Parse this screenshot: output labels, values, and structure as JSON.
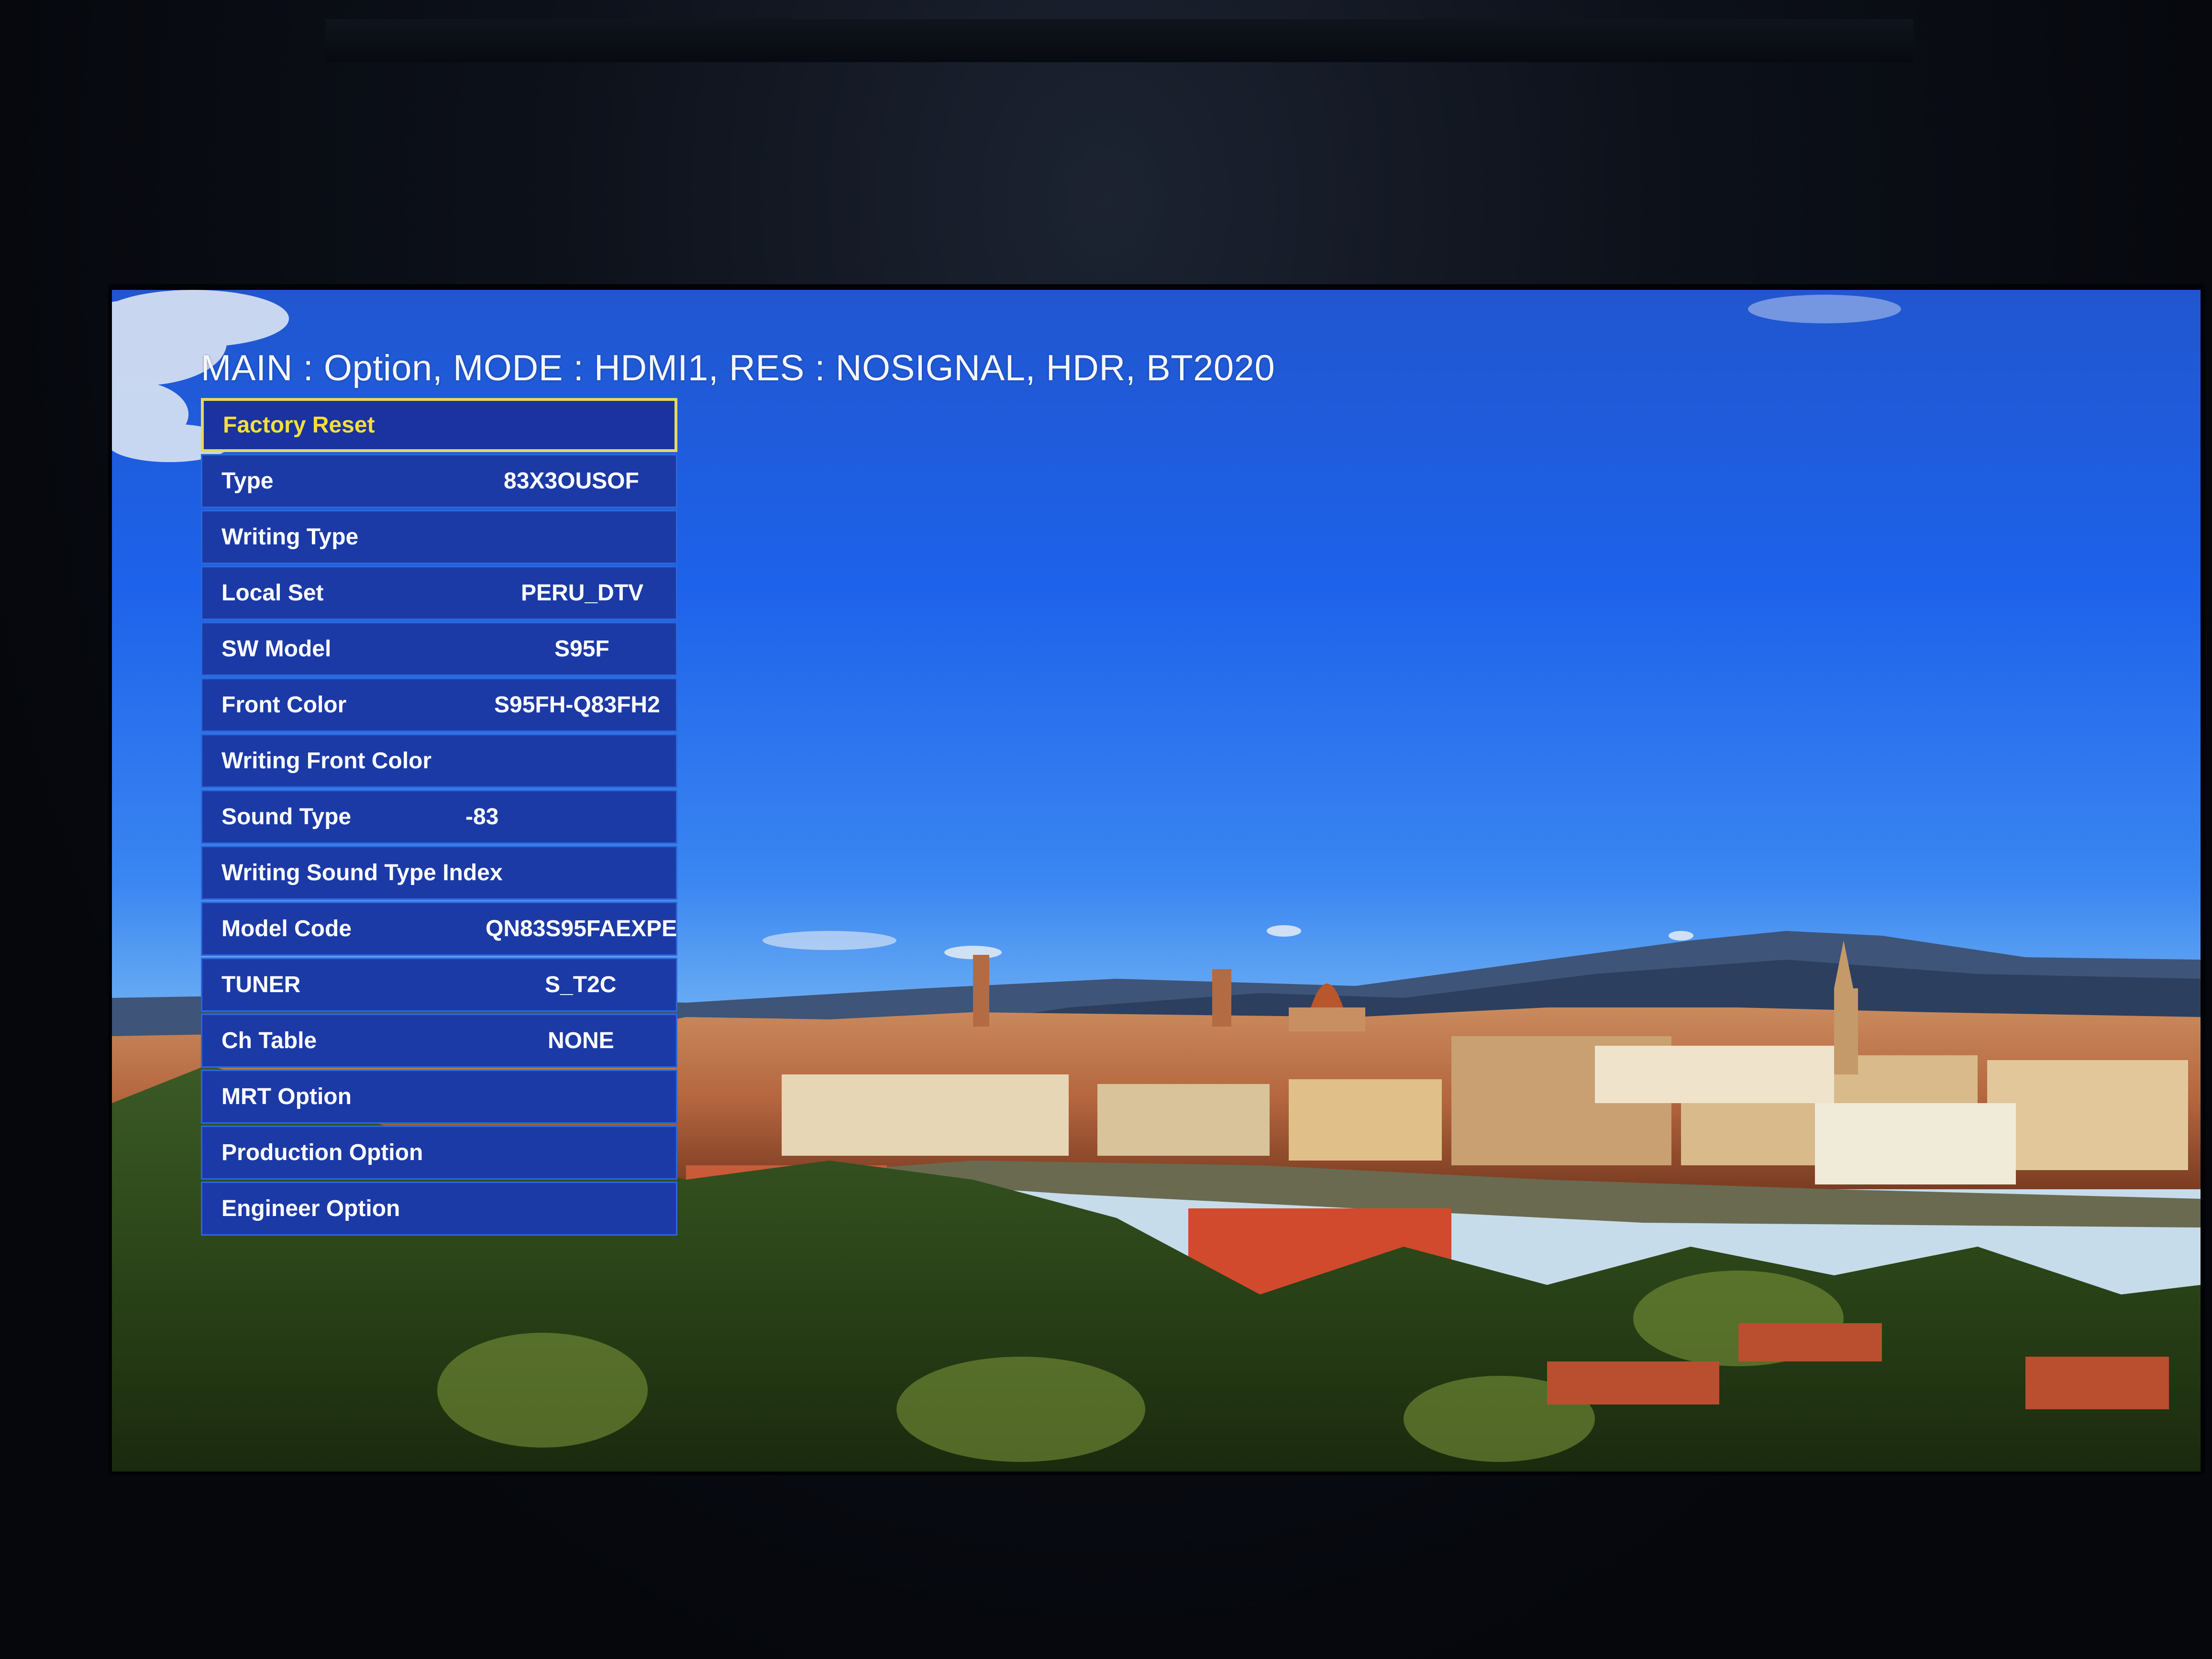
{
  "osd": {
    "header": "MAIN : Option, MODE : HDMI1, RES : NOSIGNAL, HDR, BT2020"
  },
  "menu": {
    "items": [
      {
        "label": "Factory Reset",
        "value": ""
      },
      {
        "label": "Type",
        "value": "83X3OUSOF"
      },
      {
        "label": "Writing Type",
        "value": ""
      },
      {
        "label": "Local Set",
        "value": "PERU_DTV"
      },
      {
        "label": "SW Model",
        "value": "S95F"
      },
      {
        "label": "Front Color",
        "value": "S95FH-Q83FH2"
      },
      {
        "label": "Writing Front Color",
        "value": ""
      },
      {
        "label": "Sound Type",
        "value": "-83"
      },
      {
        "label": "Writing Sound Type Index",
        "value": ""
      },
      {
        "label": "Model Code",
        "value": "QN83S95FAEXPE"
      },
      {
        "label": "TUNER",
        "value": "S_T2C"
      },
      {
        "label": "Ch Table",
        "value": "NONE"
      },
      {
        "label": "MRT Option",
        "value": ""
      },
      {
        "label": "Production Option",
        "value": ""
      },
      {
        "label": "Engineer Option",
        "value": ""
      }
    ]
  },
  "colors": {
    "menu_background": "#1c3aa6",
    "menu_border": "#2d67d8",
    "selected_border": "#e8d85c",
    "selected_text": "#f5de3a",
    "text": "#ffffff"
  }
}
